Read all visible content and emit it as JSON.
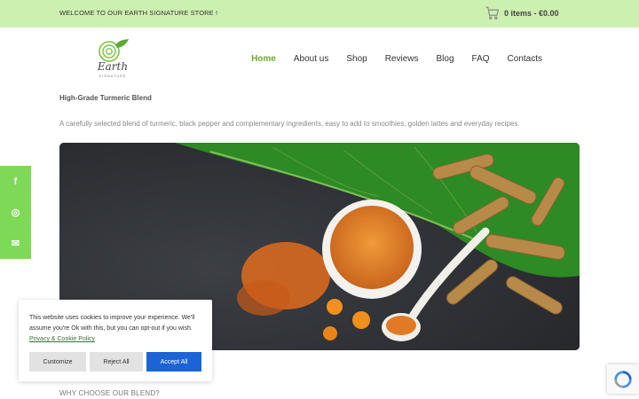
{
  "topbar": {
    "welcome": "WELCOME TO OUR EARTH SIGNATURE STORE !",
    "cart_text": "0 items - €0.00",
    "cart_icon": "cart-icon"
  },
  "logo": {
    "text": "Earth",
    "sub": "SIGNATURE"
  },
  "nav": {
    "items": [
      "Home",
      "About us",
      "Shop",
      "Reviews",
      "Blog",
      "FAQ",
      "Contacts"
    ],
    "active": "Home"
  },
  "main": {
    "product_title": "High-Grade Turmeric Blend",
    "product_desc": "A carefully selected blend of turmeric, black pepper and complementary ingredients, easy to add to smoothies, golden lattes and everyday recipes.",
    "section_label": "WHY CHOOSE OUR BLEND?"
  },
  "social": {
    "items": [
      {
        "icon": "facebook-icon",
        "glyph": "f"
      },
      {
        "icon": "instagram-icon",
        "glyph": "◎"
      },
      {
        "icon": "email-icon",
        "glyph": "✉"
      }
    ]
  },
  "cookie": {
    "message": "This website uses cookies to improve your experience. We'll assume you're Ok with this, but you can opt-out if you wish.",
    "policy_link": "Privacy & Cookie Policy",
    "customize_label": "Customize",
    "reject_label": "Reject All",
    "accept_label": "Accept All"
  },
  "colors": {
    "topbar_bg": "#ccf0b0",
    "accent": "#6aaa2f",
    "social_bg": "#7ed957",
    "accept_bg": "#1c64d6"
  }
}
